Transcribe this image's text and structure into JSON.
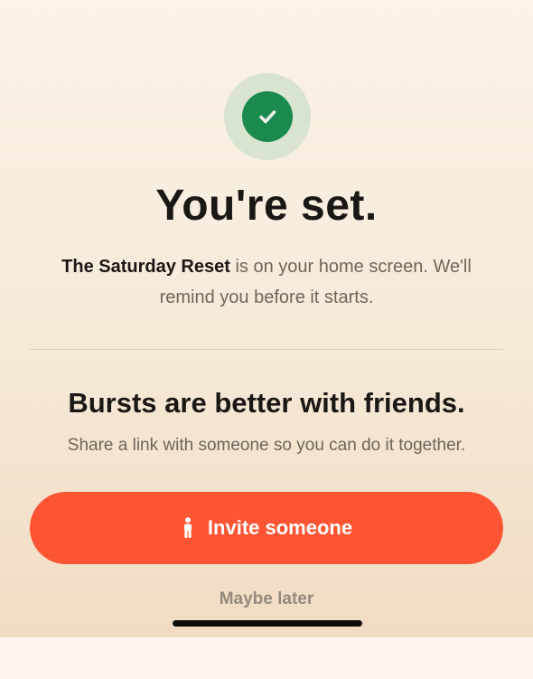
{
  "confirmation": {
    "title": "You're set.",
    "body_bold": "The Saturday Reset",
    "body_rest": " is on your home screen. We'll remind you before it starts."
  },
  "share": {
    "heading": "Bursts are better with friends.",
    "subtext": "Share a link with someone so you can do it together."
  },
  "actions": {
    "invite_label": "Invite someone",
    "maybe_later_label": "Maybe later"
  },
  "icons": {
    "status": "checkmark-icon",
    "invite": "person-icon"
  },
  "colors": {
    "accent": "#fd5533",
    "success": "#1a8a4f",
    "success_halo": "#d8e4d0",
    "heading": "#1b1714",
    "muted": "#6f655b"
  }
}
